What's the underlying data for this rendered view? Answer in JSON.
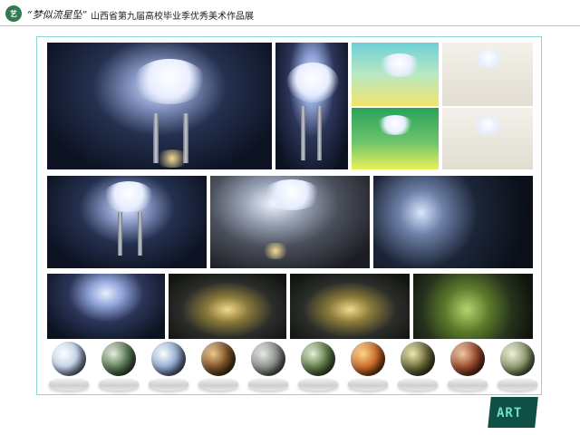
{
  "header": {
    "logo_text": "艺",
    "script_title": "“梦似流星坠”",
    "main_title": "山西省第九届高校毕业季优秀美术作品展"
  },
  "colors": {
    "frame": "#8fd3d8",
    "accent": "#2f7a55",
    "sticker_bg": "#0f4f45",
    "sticker_fg": "#6fe0c8"
  },
  "sticker": {
    "text": "ART"
  },
  "spheres": [
    {
      "tone": "#c7d7ea"
    },
    {
      "tone": "#5b7a55"
    },
    {
      "tone": "#9bb4d6"
    },
    {
      "tone": "#7a5126"
    },
    {
      "tone": "#8b8f8a"
    },
    {
      "tone": "#5f7b4a"
    },
    {
      "tone": "#c86a2a"
    },
    {
      "tone": "#6b6b3a"
    },
    {
      "tone": "#9a4b2b"
    },
    {
      "tone": "#8b9b6f"
    }
  ]
}
